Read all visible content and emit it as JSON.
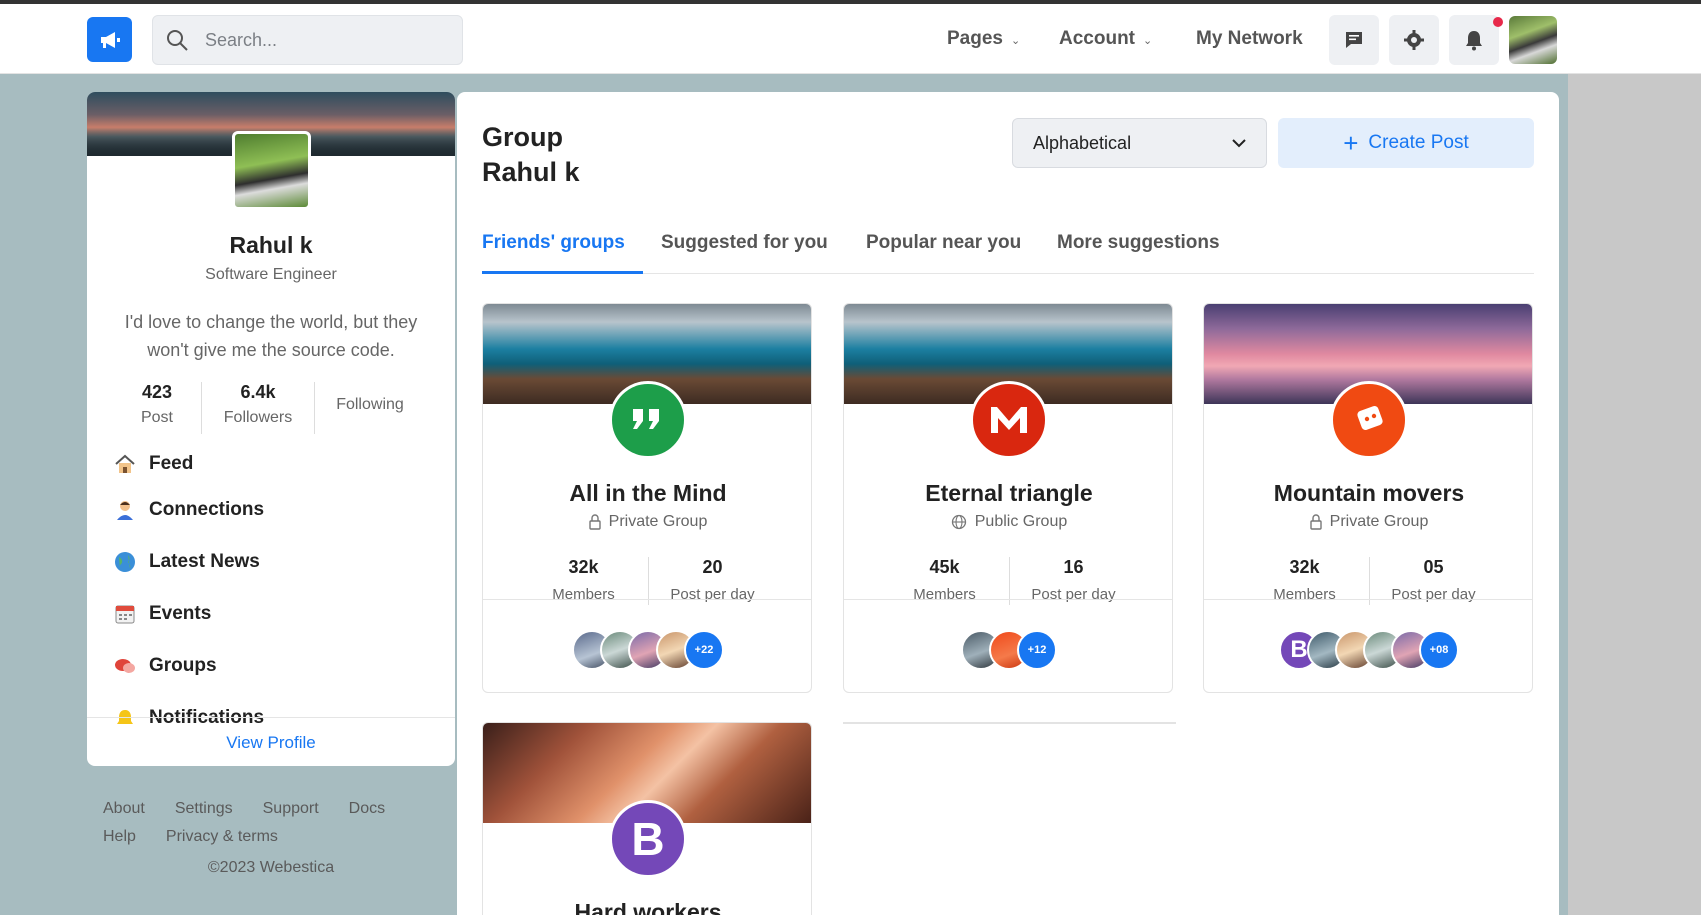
{
  "search": {
    "placeholder": "Search..."
  },
  "nav": {
    "pages": "Pages",
    "account": "Account",
    "my_network": "My Network"
  },
  "profile": {
    "name": "Rahul k",
    "role": "Software Engineer",
    "bio": "I'd love to change the world, but they won't give me the source code.",
    "stats": [
      {
        "value": "423",
        "label": "Post"
      },
      {
        "value": "6.4k",
        "label": "Followers"
      },
      {
        "value": "",
        "label": "Following"
      }
    ],
    "menu": [
      "Feed",
      "Connections",
      "Latest News",
      "Events",
      "Groups",
      "Notifications"
    ],
    "view_profile": "View Profile"
  },
  "footer": {
    "links_row1": [
      "About",
      "Settings",
      "Support",
      "Docs"
    ],
    "links_row2": [
      "Help",
      "Privacy & terms"
    ],
    "copyright": "©2023 Webestica"
  },
  "main": {
    "title_line1": "Group",
    "title_line2": "Rahul k",
    "sort_value": "Alphabetical",
    "create_label": "Create Post",
    "tabs": [
      "Friends' groups",
      "Suggested for you",
      "Popular near you",
      "More suggestions"
    ],
    "groups": [
      {
        "name": "All in the Mind",
        "type": "Private Group",
        "members": "32k",
        "members_label": "Members",
        "posts": "20",
        "posts_label": "Post per day",
        "more": "+22",
        "icon_color": "#1d9e4a"
      },
      {
        "name": "Eternal triangle",
        "type": "Public Group",
        "members": "45k",
        "members_label": "Members",
        "posts": "16",
        "posts_label": "Post per day",
        "more": "+12",
        "icon_color": "#d9270f"
      },
      {
        "name": "Mountain movers",
        "type": "Private Group",
        "members": "32k",
        "members_label": "Members",
        "posts": "05",
        "posts_label": "Post per day",
        "more": "+08",
        "icon_color": "#f04a12"
      },
      {
        "name": "Hard workers",
        "type": "",
        "icon_letter": "B",
        "icon_color": "#7448b8"
      }
    ]
  }
}
